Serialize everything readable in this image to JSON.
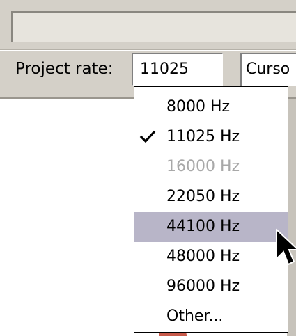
{
  "toolbar": {
    "project_rate_label": "Project rate:",
    "project_rate_value": "11025",
    "cursor_label": "Curso"
  },
  "dropdown": {
    "items": [
      {
        "label": "8000 Hz",
        "checked": false,
        "disabled": false,
        "highlighted": false
      },
      {
        "label": "11025 Hz",
        "checked": true,
        "disabled": false,
        "highlighted": false
      },
      {
        "label": "16000 Hz",
        "checked": false,
        "disabled": true,
        "highlighted": false
      },
      {
        "label": "22050 Hz",
        "checked": false,
        "disabled": false,
        "highlighted": false
      },
      {
        "label": "44100 Hz",
        "checked": false,
        "disabled": false,
        "highlighted": true
      },
      {
        "label": "48000 Hz",
        "checked": false,
        "disabled": false,
        "highlighted": false
      },
      {
        "label": "96000 Hz",
        "checked": false,
        "disabled": false,
        "highlighted": false
      },
      {
        "label": "Other...",
        "checked": false,
        "disabled": false,
        "highlighted": false
      }
    ]
  },
  "icons": {
    "check": "checkmark-icon",
    "pointer": "mouse-pointer-icon"
  },
  "colors": {
    "toolbar_bg": "#d4d0c8",
    "highlight": "#b8b5c8",
    "disabled_text": "#a8a8a8"
  }
}
